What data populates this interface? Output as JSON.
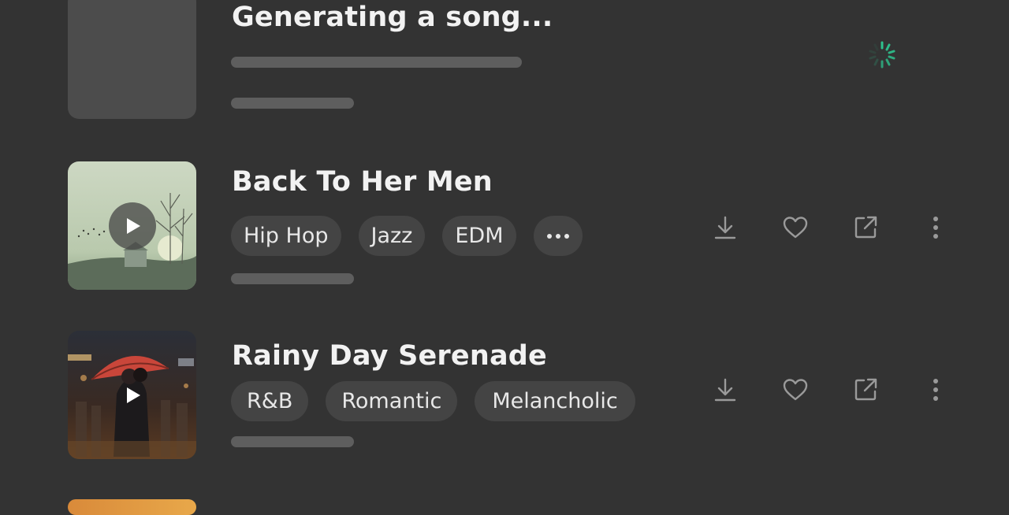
{
  "generating": {
    "title": "Generating a song..."
  },
  "songs": [
    {
      "title": "Back To Her Men",
      "tags": [
        "Hip Hop",
        "Jazz",
        "EDM"
      ],
      "has_more": true
    },
    {
      "title": "Rainy Day Serenade",
      "tags": [
        "R&B",
        "Romantic",
        "Melancholic"
      ],
      "has_more": false
    }
  ],
  "icons": {
    "download": "download-icon",
    "like": "heart-icon",
    "share": "share-icon",
    "more": "more-vertical-icon",
    "play": "play-icon",
    "loading": "loading-spinner-icon"
  },
  "colors": {
    "background": "#333333",
    "tag_background": "#444444",
    "accent_spinner": "#2ec28e"
  }
}
